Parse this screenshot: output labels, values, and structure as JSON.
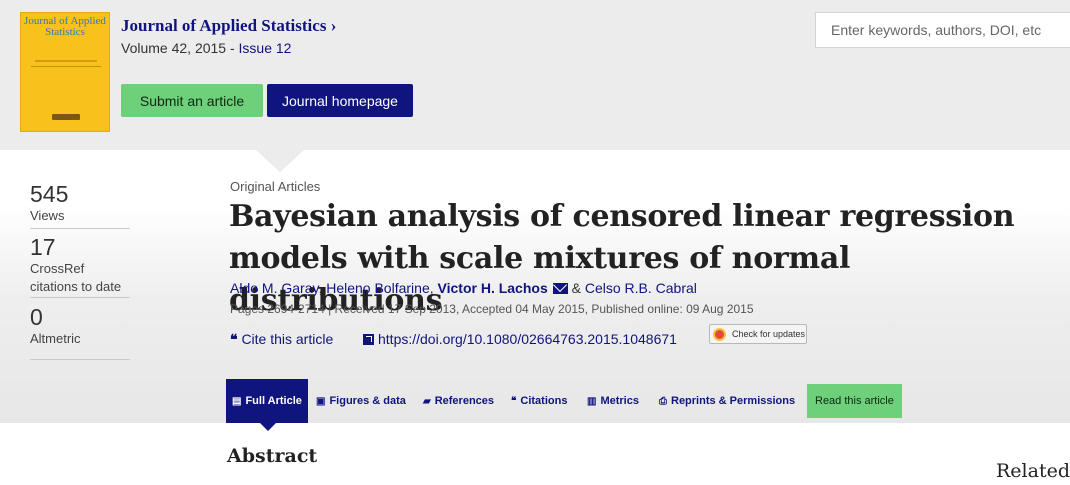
{
  "header": {
    "cover_title": "Journal of Applied Statistics",
    "journal_title": "Journal of Applied Statistics ›",
    "volume": "Volume 42, 2015",
    "volume_sep": " - ",
    "issue": "Issue 12",
    "submit_label": "Submit an article",
    "homepage_label": "Journal homepage",
    "search_placeholder": "Enter keywords, authors, DOI, etc"
  },
  "metrics": [
    {
      "value": "545",
      "label": "Views"
    },
    {
      "value": "17",
      "label": "CrossRef citations to date"
    },
    {
      "value": "0",
      "label": "Altmetric"
    }
  ],
  "article": {
    "type": "Original Articles",
    "title": "Bayesian analysis of censored linear regression models with scale mixtures of normal distributions",
    "authors": {
      "a1": "Aldo M. Garay",
      "sep1": ", ",
      "a2": "Heleno Bolfarine",
      "sep2": ", ",
      "a3": "Victor H. Lachos",
      "sep3": " & ",
      "a4": "Celso R.B. Cabral"
    },
    "pub_info": "Pages 2694-2714 | Received 17 Sep 2013, Accepted 04 May 2015, Published online: 09 Aug 2015",
    "cite_label": "Cite this article",
    "doi": "https://doi.org/10.1080/02664763.2015.1048671",
    "check_updates": "Check for updates"
  },
  "tabs": [
    {
      "label": "Full Article",
      "icon": "document-icon"
    },
    {
      "label": "Figures & data",
      "icon": "image-icon"
    },
    {
      "label": "References",
      "icon": "book-icon"
    },
    {
      "label": "Citations",
      "icon": "quote-icon"
    },
    {
      "label": "Metrics",
      "icon": "bar-chart-icon"
    },
    {
      "label": "Reprints & Permissions",
      "icon": "print-icon"
    },
    {
      "label": "Read this article",
      "icon": ""
    }
  ],
  "sections": {
    "abstract": "Abstract",
    "related": "Related"
  },
  "colors": {
    "brand_navy": "#10147e",
    "accent_green": "#6ed07a",
    "cover_yellow": "#f8c21c"
  }
}
